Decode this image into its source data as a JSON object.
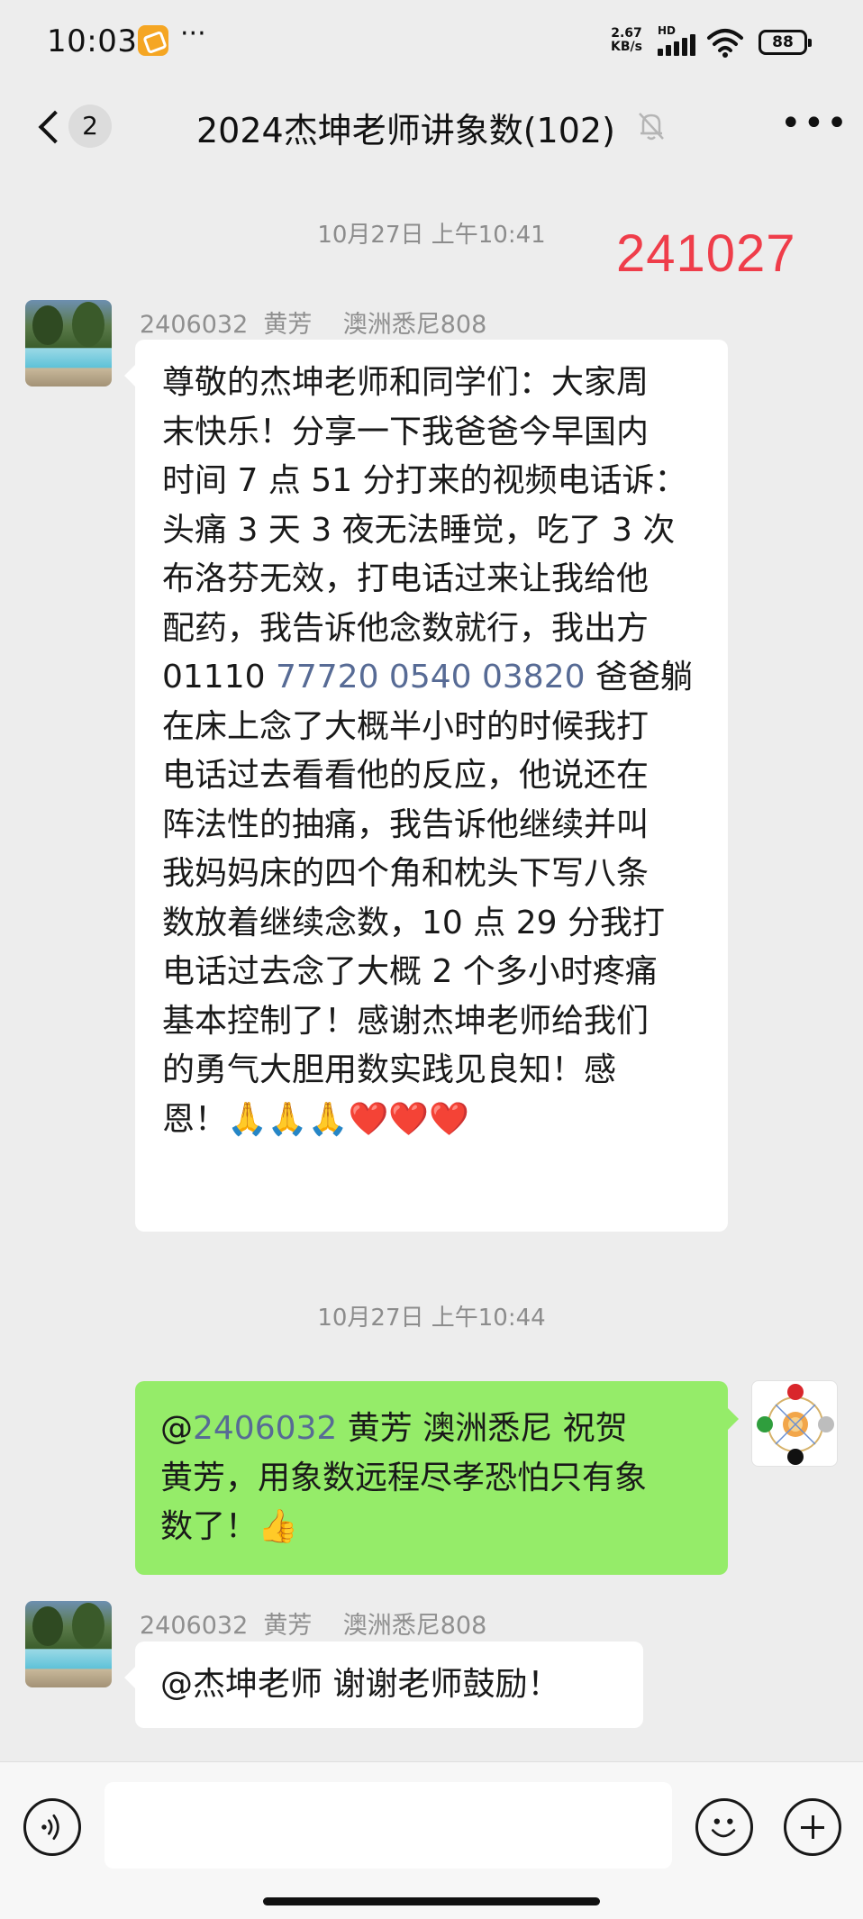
{
  "status_bar": {
    "time": "10:03",
    "dots": "···",
    "net_speed_value": "2.67",
    "net_speed_unit": "KB/s",
    "hd": "HD",
    "battery": "88"
  },
  "nav": {
    "unread_count": "2",
    "title": "2024杰坤老师讲象数(102)"
  },
  "red_stamp": "241027",
  "messages": [
    {
      "timestamp": "10月27日 上午10:41",
      "sender": "2406032  黄芳    澳洲悉尼808",
      "side": "left",
      "lines": [
        "尊敬的杰坤老师和同学们：大家周",
        "末快乐！分享一下我爸爸今早国内",
        "时间 7 点 51 分打来的视频电话诉：",
        "头痛 3 天 3 夜无法睡觉，吃了 3 次",
        "布洛芬无效，打电话过来让我给他",
        "配药，我告诉他念数就行，我出方"
      ],
      "line7_prefix": "01110 ",
      "line7_link": "77720 0540 03820",
      "line7_suffix": " 爸爸躺",
      "lines_after": [
        "在床上念了大概半小时的时候我打",
        "电话过去看看他的反应，他说还在",
        "阵法性的抽痛，我告诉他继续并叫",
        "我妈妈床的四个角和枕头下写八条",
        "数放着继续念数，10 点 29 分我打",
        "电话过去念了大概 2 个多小时疼痛",
        "基本控制了！感谢杰坤老师给我们",
        "的勇气大胆用数实践见良知！感"
      ],
      "last_line": "恩！🙏🙏🙏❤️❤️❤️"
    },
    {
      "timestamp": "10月27日 上午10:44",
      "side": "right",
      "mention_at": "@",
      "mention_link": "2406032",
      "line1_rest": " 黄芳    澳洲悉尼  祝贺",
      "line2": "黄芳，用象数远程尽孝恐怕只有象",
      "line3": "数了！👍"
    },
    {
      "sender": "2406032  黄芳    澳洲悉尼808",
      "side": "left",
      "text": "@杰坤老师  谢谢老师鼓励！"
    }
  ]
}
